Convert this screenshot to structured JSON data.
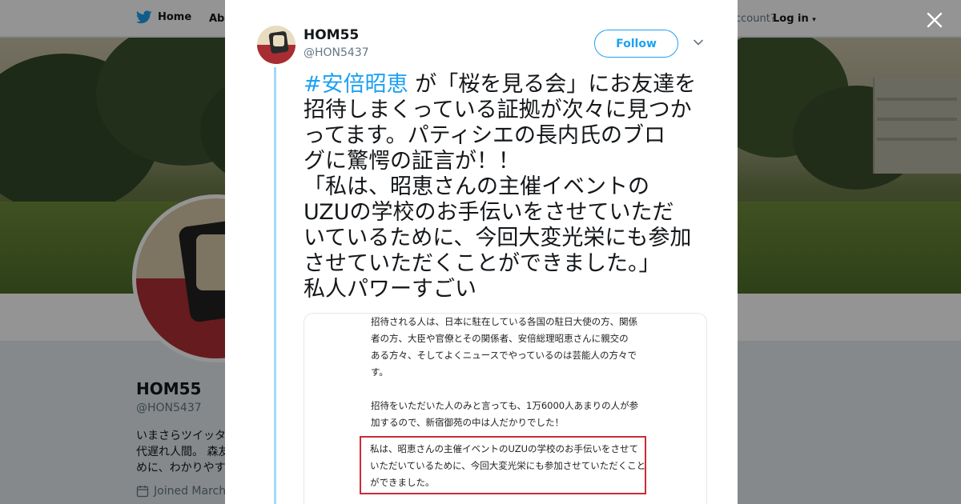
{
  "topbar": {
    "home_label": "Home",
    "about_label": "Abo",
    "account_prompt": "ccount?",
    "login_label": "Log in"
  },
  "profile": {
    "name": "HOM55",
    "handle": "@HON5437",
    "bio_lines": [
      "いまさらツイッタ",
      "代遅れ人間。 森友",
      "めに、わかりやす"
    ],
    "joined": "Joined March"
  },
  "tweet": {
    "author_name": "HOM55",
    "author_handle": "@HON5437",
    "follow_label": "Follow",
    "hashtag": "#安倍昭恵",
    "first_line_rest": " が「桜を見る会」にお友達を",
    "lines": [
      "招待しまくっている証拠が次々に見つか",
      "ってます。パティシエの長内氏のブロ",
      "グに驚愕の証言が！！",
      "「私は、昭恵さんの主催イベントの",
      "UZUの学校のお手伝いをさせていただ",
      "いているために、今回大変光栄にも参加",
      "させていただくことができました。」",
      "私人パワーすごい"
    ]
  },
  "media": {
    "paragraph1": [
      "招待される人は、日本に駐在している各国の駐日大使の方、関係",
      "者の方、大臣や官僚とその関係者、安倍総理昭恵さんに親交の",
      "ある方々、そしてよくニュースでやっているのは芸能人の方々で",
      "す。"
    ],
    "paragraph2": [
      "招待をいただいた人のみと言っても、1万6000人あまりの人が参",
      "加するので、新宿御苑の中は人だかりでした！"
    ],
    "quote": [
      "私は、昭恵さんの主催イベントのUZUの学校のお手伝いをさせて",
      "いただいているために、今回大変光栄にも参加させていただくこと",
      "ができました。"
    ]
  },
  "colors": {
    "accent": "#1da1f2",
    "thread_line": "#a6d7f8",
    "quote_border": "#cc2b36"
  },
  "icons": {
    "home": "bird-icon",
    "close": "close-icon",
    "caret": "chevron-down-icon",
    "calendar": "calendar-icon"
  }
}
